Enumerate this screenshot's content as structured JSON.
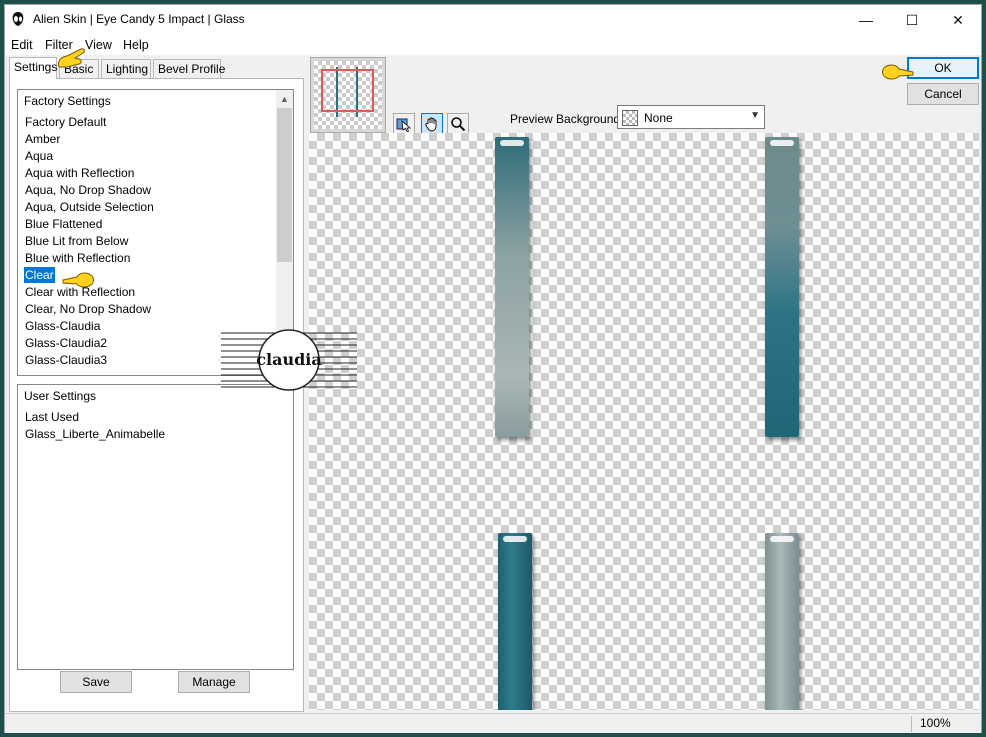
{
  "window": {
    "title": "Alien Skin | Eye Candy 5 Impact | Glass",
    "minimize_icon": "—",
    "maximize_icon": "☐",
    "close_icon": "✕"
  },
  "menu": [
    "Edit",
    "Filter",
    "View",
    "Help"
  ],
  "tabs": [
    "Settings",
    "Basic",
    "Lighting",
    "Bevel Profile"
  ],
  "factory": {
    "header": "Factory Settings",
    "items": [
      "Factory Default",
      "Amber",
      "Aqua",
      "Aqua with Reflection",
      "Aqua, No Drop Shadow",
      "Aqua, Outside Selection",
      "Blue Flattened",
      "Blue Lit from Below",
      "Blue with Reflection",
      "Clear",
      "Clear with Reflection",
      "Clear, No Drop Shadow",
      "Glass-Claudia",
      "Glass-Claudia2",
      "Glass-Claudia3"
    ],
    "selected": "Clear"
  },
  "user": {
    "header": "User Settings",
    "items": [
      "Last Used",
      "Glass_Liberte_Animabelle"
    ]
  },
  "buttons": {
    "save": "Save",
    "manage": "Manage",
    "ok": "OK",
    "cancel": "Cancel"
  },
  "preview": {
    "label": "Preview Background:",
    "value": "None"
  },
  "status": {
    "zoom": "100%"
  },
  "watermark": {
    "text": "claudia"
  },
  "colors": {
    "accent": "#0078d7",
    "teal": "#2f7d8e",
    "grey": "#aab8b8"
  }
}
